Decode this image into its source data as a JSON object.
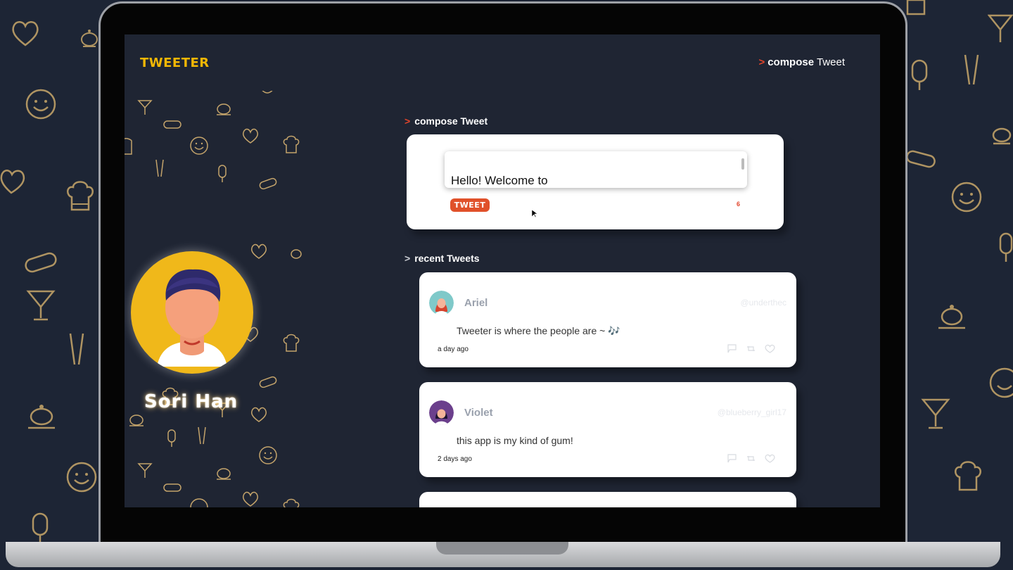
{
  "app": {
    "brand": "TWEETER",
    "nav": {
      "chevron": ">",
      "compose_bold": "compose",
      "compose_rest": "Tweet"
    }
  },
  "profile": {
    "name": "Sori Han",
    "avatar_icon": "user-avatar-icon"
  },
  "compose": {
    "heading_chevron": ">",
    "heading": "compose Tweet",
    "text": "Hello! Welcome to",
    "button_label": "TWEET",
    "char_counter": "6"
  },
  "recent": {
    "heading_chevron": ">",
    "heading": "recent Tweets",
    "tweets": [
      {
        "name": "Ariel",
        "handle": "@underthec",
        "body": "Tweeter is where the people are ~ 🎶",
        "time": "a day ago",
        "avatar_color": "#7fc9c9"
      },
      {
        "name": "Violet",
        "handle": "@blueberry_girl17",
        "body": "this app is my kind of gum!",
        "time": "2 days ago",
        "avatar_color": "#6b3f8c"
      }
    ]
  },
  "colors": {
    "accent": "#e2452b",
    "brand_yellow": "#f2b705",
    "background": "#1d2535",
    "pattern": "#c9a86a"
  }
}
